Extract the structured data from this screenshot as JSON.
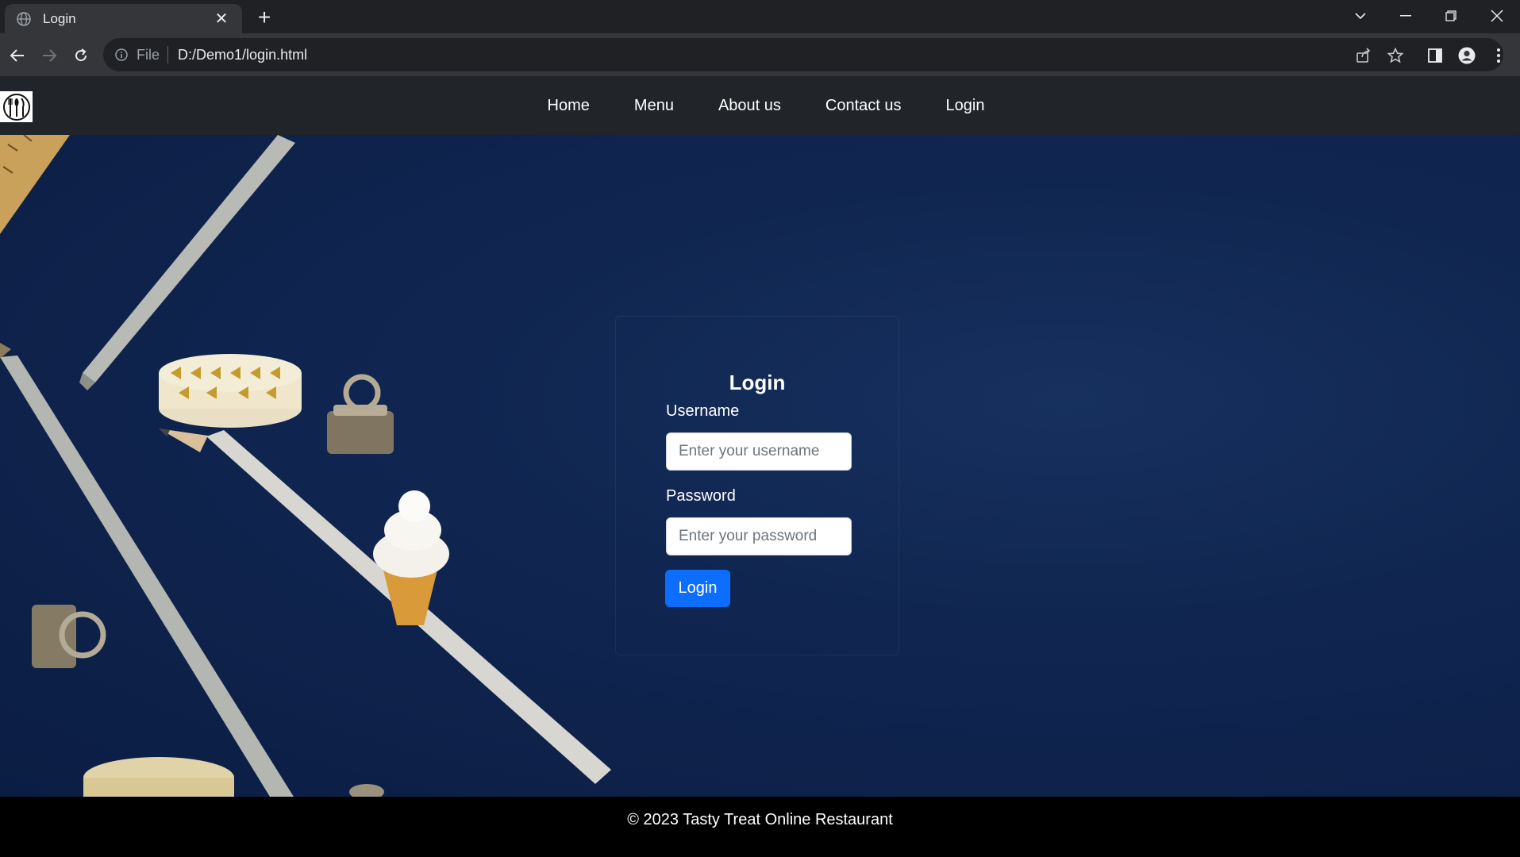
{
  "browser": {
    "tab_title": "Login",
    "url_scheme": "File",
    "url": "D:/Demo1/login.html",
    "theme": {
      "frame": "#202124",
      "toolbar": "#35363a",
      "text": "#e8eaed"
    }
  },
  "site": {
    "nav": {
      "items": [
        {
          "label": "Home"
        },
        {
          "label": "Menu"
        },
        {
          "label": "About us"
        },
        {
          "label": "Contact us"
        },
        {
          "label": "Login"
        }
      ]
    },
    "login": {
      "title": "Login",
      "username_label": "Username",
      "username_placeholder": "Enter your username",
      "password_label": "Password",
      "password_placeholder": "Enter your password",
      "submit_label": "Login"
    },
    "footer": {
      "text": "© 2023 Tasty Treat Online Restaurant"
    },
    "colors": {
      "navbar_bg": "#212529",
      "hero_bg": "#0d2149",
      "primary_button": "#0d6efd",
      "footer_bg": "#000000"
    }
  }
}
